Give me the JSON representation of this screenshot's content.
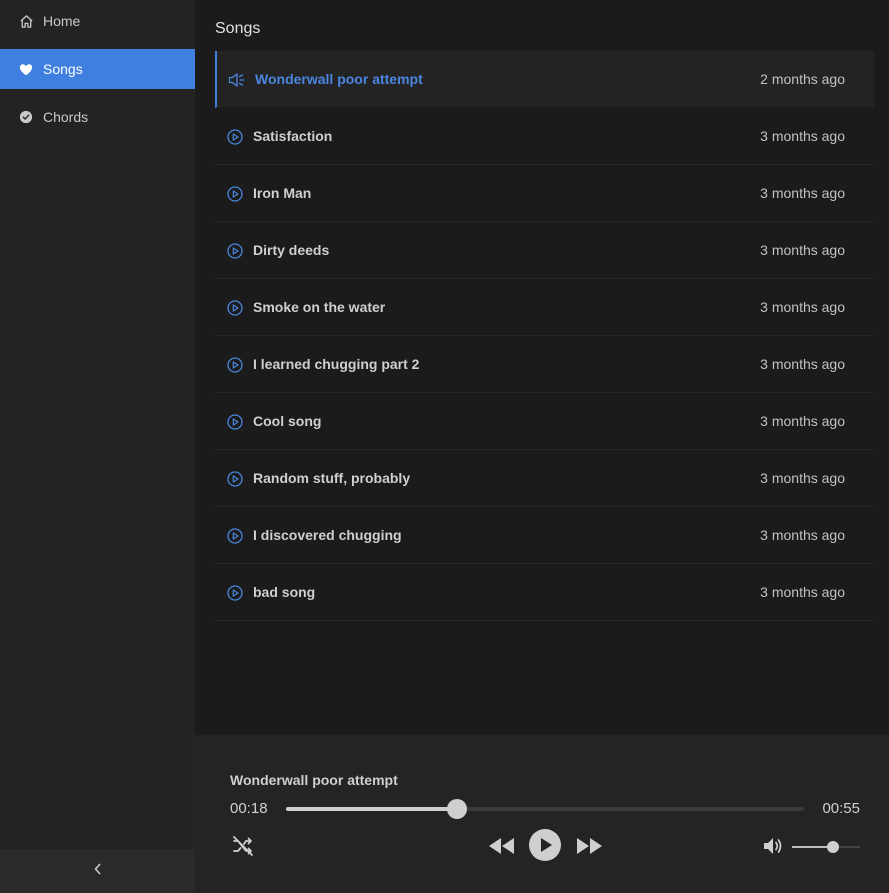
{
  "sidebar": {
    "items": [
      {
        "label": "Home",
        "icon": "home-icon",
        "active": false
      },
      {
        "label": "Songs",
        "icon": "heart-icon",
        "active": true
      },
      {
        "label": "Chords",
        "icon": "check-circle-icon",
        "active": false
      }
    ],
    "collapse_icon": "chevron-left-icon"
  },
  "main": {
    "title": "Songs",
    "songs": [
      {
        "title": "Wonderwall poor attempt",
        "time": "2 months ago",
        "playing": true
      },
      {
        "title": "Satisfaction",
        "time": "3 months ago"
      },
      {
        "title": "Iron Man",
        "time": "3 months ago"
      },
      {
        "title": "Dirty deeds",
        "time": "3 months ago"
      },
      {
        "title": "Smoke on the water",
        "time": "3 months ago"
      },
      {
        "title": "I learned chugging part 2",
        "time": "3 months ago"
      },
      {
        "title": "Cool song",
        "time": "3 months ago"
      },
      {
        "title": "Random stuff, probably",
        "time": "3 months ago"
      },
      {
        "title": "I discovered chugging",
        "time": "3 months ago"
      },
      {
        "title": "bad song",
        "time": "3 months ago"
      }
    ]
  },
  "player": {
    "now_playing": "Wonderwall poor attempt",
    "current_time": "00:18",
    "total_time": "00:55",
    "progress_fraction": 0.33,
    "volume_fraction": 0.6
  },
  "colors": {
    "accent": "#3f7fe0",
    "background": "#1b1b1b",
    "sidebar": "#232323",
    "player": "#242424"
  }
}
